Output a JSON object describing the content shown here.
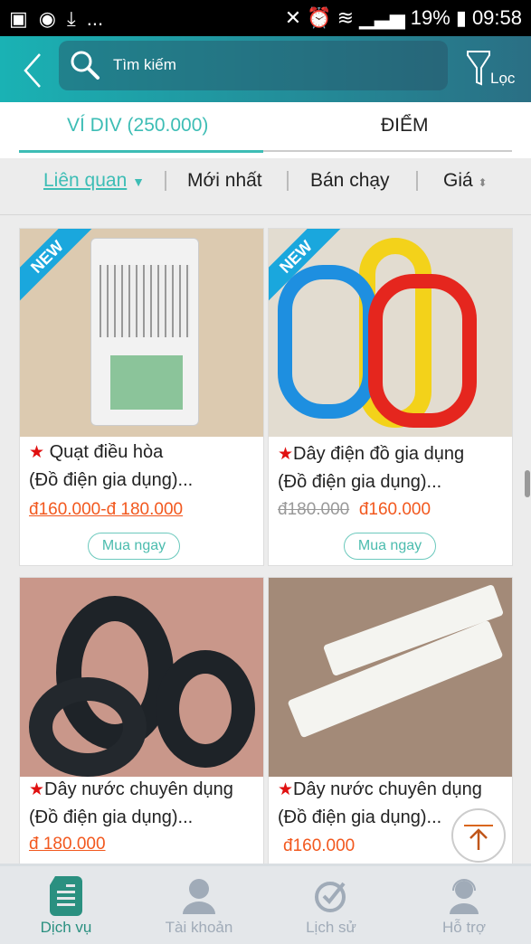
{
  "status_bar": {
    "battery": "19%",
    "time": "09:58",
    "more": "..."
  },
  "header": {
    "search_placeholder": "Tìm kiếm",
    "filter_label": "Lọc"
  },
  "tabs": [
    {
      "label": "VÍ DIV  (250.000)",
      "active": true
    },
    {
      "label": "ĐIỂM",
      "active": false
    }
  ],
  "sort": [
    {
      "label": "Liên quan",
      "active": true
    },
    {
      "label": "Mới nhất"
    },
    {
      "label": "Bán chạy"
    },
    {
      "label": "Giá"
    }
  ],
  "colors": {
    "accent": "#3dbdb5",
    "price": "#f2581e",
    "star": "#e01010",
    "new_badge": "#1aa7dd"
  },
  "products": [
    {
      "badge": "NEW",
      "title1": "Quạt điều hòa",
      "title2": "(Đồ điện gia dụng)...",
      "price": "đ160.000-đ 180.000",
      "buy": "Mua ngay"
    },
    {
      "badge": "NEW",
      "title1": "Dây điện đồ gia dụng",
      "title2": "(Đồ điện gia dụng)...",
      "old_price": "đ180.000",
      "price": "đ160.000",
      "buy": "Mua ngay"
    },
    {
      "title1": "Dây nước chuyên dụng",
      "title2": "(Đồ điện gia dụng)...",
      "price": "đ 180.000"
    },
    {
      "title1": "Dây nước chuyên dụng",
      "title2": "(Đồ điện gia dụng)...",
      "price": "đ160.000"
    }
  ],
  "nav": [
    {
      "label": "Dịch vụ",
      "icon": "document-icon",
      "active": true
    },
    {
      "label": "Tài khoản",
      "icon": "user-icon"
    },
    {
      "label": "Lịch sử",
      "icon": "clock-check-icon"
    },
    {
      "label": "Hỗ trợ",
      "icon": "headset-icon"
    }
  ]
}
